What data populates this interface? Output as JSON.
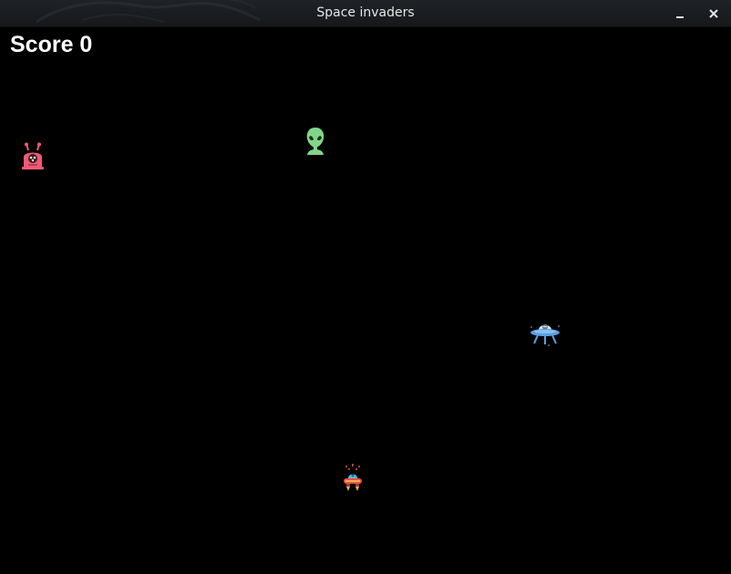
{
  "window": {
    "title": "Space invaders"
  },
  "hud": {
    "score_label": "Score 0",
    "score_value": 0
  },
  "sprites": {
    "enemy_pink": "pink-alien-enemy-icon",
    "enemy_green": "green-alien-head-enemy-icon",
    "enemy_ufo": "blue-ufo-enemy-icon",
    "player": "player-spaceship-icon"
  },
  "colors": {
    "background": "#000000",
    "titlebar": "#1b1d20",
    "title_text": "#e6e6e6",
    "score_text": "#ffffff",
    "pink_alien": "#ef5a74",
    "green_alien": "#7fd68a",
    "ufo": "#5b9fe0",
    "player_body": "#e8504d"
  }
}
